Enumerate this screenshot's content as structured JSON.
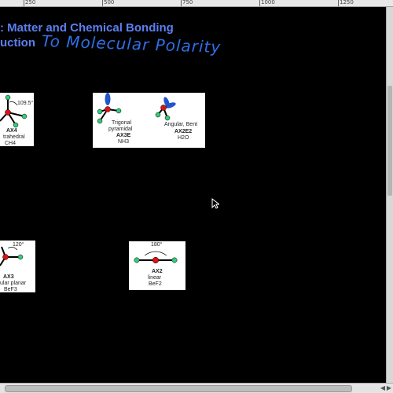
{
  "ruler": {
    "ticks": [
      "250",
      "500",
      "750",
      "1000",
      "1250"
    ]
  },
  "slide": {
    "title_line1": ": Matter and Chemical Bonding",
    "title_line2": "uction",
    "handwritten": "To Molecular Polarity"
  },
  "cards": {
    "tetrahedral": {
      "angle": "109.5°",
      "formula": "AX4",
      "name": "trahedral",
      "compound": "CH4"
    },
    "trigonal_pyramidal": {
      "name_line1": "Trigonal",
      "name_line2": "pyramidal",
      "formula": "AX3E",
      "compound": "NH3"
    },
    "angular_bent": {
      "name": "Angular, Bent",
      "formula": "AX2E2",
      "compound": "H2O"
    },
    "trigonal_planar": {
      "angle": "120°",
      "formula": "AX3",
      "name": "ular planar",
      "compound": "BeF3"
    },
    "linear": {
      "angle": "180°",
      "formula": "AX2",
      "name": "linear",
      "compound": "BeF2"
    }
  },
  "colors": {
    "title": "#5b7ff0",
    "handwriting": "#2f6fe8",
    "atom_center": "#dd1111",
    "atom_outer": "#33cc77",
    "lone_pair": "#2255cc"
  }
}
